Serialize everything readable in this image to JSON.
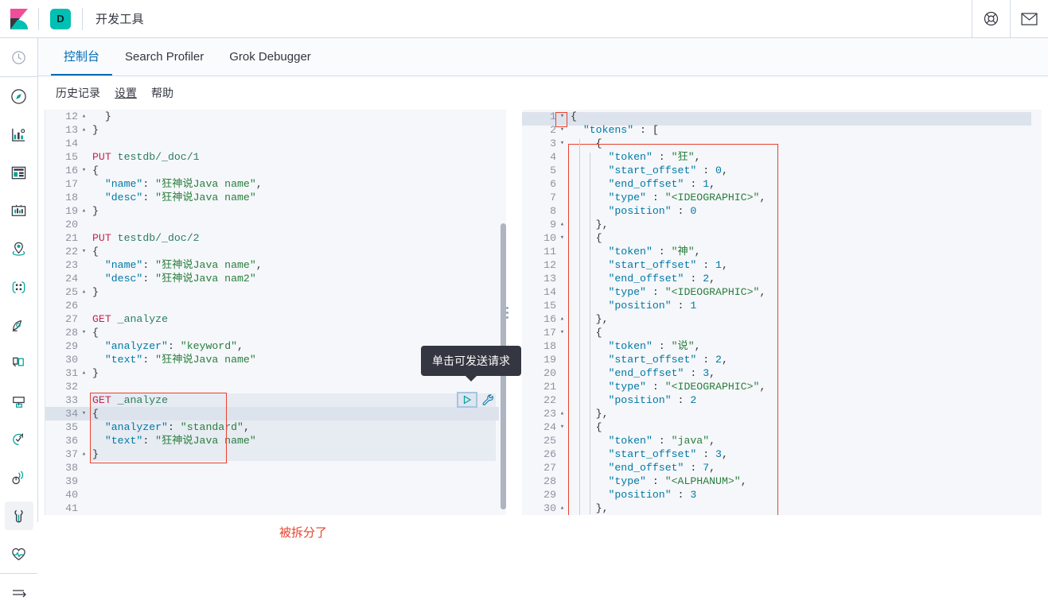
{
  "header": {
    "logo_icon": "kibana-logo",
    "space_badge": "D",
    "app_title": "开发工具",
    "help_icon": "lifebuoy-help-icon",
    "mail_icon": "envelope-icon"
  },
  "sidebar": {
    "items": [
      {
        "icon": "clock-recently-viewed-icon",
        "active": false
      },
      {
        "icon": "compass-discover-icon",
        "active": false
      },
      {
        "icon": "bar-chart-visualize-icon",
        "active": false
      },
      {
        "icon": "dashboard-icon",
        "active": false
      },
      {
        "icon": "canvas-icon",
        "active": false
      },
      {
        "icon": "maps-location-icon",
        "active": false
      },
      {
        "icon": "machine-learning-icon",
        "active": false
      },
      {
        "icon": "infra-metrics-icon",
        "active": false
      },
      {
        "icon": "logs-icon",
        "active": false
      },
      {
        "icon": "apm-icon",
        "active": false
      },
      {
        "icon": "uptime-signal-icon",
        "active": false
      },
      {
        "icon": "wrench-dev-tools-icon",
        "active": true
      },
      {
        "icon": "heartbeat-monitoring-icon",
        "active": false
      },
      {
        "icon": "collapse-arrow-icon",
        "active": false
      }
    ]
  },
  "tabs": [
    {
      "label": "控制台",
      "active": true
    },
    {
      "label": "Search Profiler",
      "active": false
    },
    {
      "label": "Grok Debugger",
      "active": false
    }
  ],
  "console_toolbar": {
    "links": [
      {
        "label": "历史记录",
        "underline": false
      },
      {
        "label": "设置",
        "underline": true
      },
      {
        "label": "帮助",
        "underline": false
      }
    ]
  },
  "tooltip": {
    "text": "单击可发送请求"
  },
  "annotations": {
    "note_text": "被拆分了",
    "note_color": "#e8422e"
  },
  "actions": {
    "play_icon": "play-send-request-icon",
    "wrench_icon": "wrench-settings-icon"
  },
  "request_editor": {
    "first_line_number": 12,
    "lines": [
      {
        "n": 12,
        "fold": "up",
        "tokens": [
          {
            "t": "  }",
            "c": "brace"
          }
        ]
      },
      {
        "n": 13,
        "fold": "up",
        "tokens": [
          {
            "t": "}",
            "c": "brace"
          }
        ]
      },
      {
        "n": 14,
        "fold": "",
        "tokens": []
      },
      {
        "n": 15,
        "fold": "",
        "tokens": [
          {
            "t": "PUT",
            "c": "method"
          },
          {
            "t": " ",
            "c": "punc"
          },
          {
            "t": "testdb/_doc/1",
            "c": "url"
          }
        ]
      },
      {
        "n": 16,
        "fold": "down",
        "tokens": [
          {
            "t": "{",
            "c": "brace"
          }
        ]
      },
      {
        "n": 17,
        "fold": "",
        "tokens": [
          {
            "t": "  ",
            "c": "punc"
          },
          {
            "t": "\"name\"",
            "c": "key"
          },
          {
            "t": ": ",
            "c": "punc"
          },
          {
            "t": "\"狂神说Java name\"",
            "c": "str"
          },
          {
            "t": ",",
            "c": "punc"
          }
        ]
      },
      {
        "n": 18,
        "fold": "",
        "tokens": [
          {
            "t": "  ",
            "c": "punc"
          },
          {
            "t": "\"desc\"",
            "c": "key"
          },
          {
            "t": ": ",
            "c": "punc"
          },
          {
            "t": "\"狂神说Java name\"",
            "c": "str"
          }
        ]
      },
      {
        "n": 19,
        "fold": "up",
        "tokens": [
          {
            "t": "}",
            "c": "brace"
          }
        ]
      },
      {
        "n": 20,
        "fold": "",
        "tokens": []
      },
      {
        "n": 21,
        "fold": "",
        "tokens": [
          {
            "t": "PUT",
            "c": "method"
          },
          {
            "t": " ",
            "c": "punc"
          },
          {
            "t": "testdb/_doc/2",
            "c": "url"
          }
        ]
      },
      {
        "n": 22,
        "fold": "down",
        "tokens": [
          {
            "t": "{",
            "c": "brace"
          }
        ]
      },
      {
        "n": 23,
        "fold": "",
        "tokens": [
          {
            "t": "  ",
            "c": "punc"
          },
          {
            "t": "\"name\"",
            "c": "key"
          },
          {
            "t": ": ",
            "c": "punc"
          },
          {
            "t": "\"狂神说Java name\"",
            "c": "str"
          },
          {
            "t": ",",
            "c": "punc"
          }
        ]
      },
      {
        "n": 24,
        "fold": "",
        "tokens": [
          {
            "t": "  ",
            "c": "punc"
          },
          {
            "t": "\"desc\"",
            "c": "key"
          },
          {
            "t": ": ",
            "c": "punc"
          },
          {
            "t": "\"狂神说Java nam2\"",
            "c": "str"
          }
        ]
      },
      {
        "n": 25,
        "fold": "up",
        "tokens": [
          {
            "t": "}",
            "c": "brace"
          }
        ]
      },
      {
        "n": 26,
        "fold": "",
        "tokens": []
      },
      {
        "n": 27,
        "fold": "",
        "tokens": [
          {
            "t": "GET",
            "c": "method"
          },
          {
            "t": " ",
            "c": "punc"
          },
          {
            "t": "_analyze",
            "c": "url"
          }
        ]
      },
      {
        "n": 28,
        "fold": "down",
        "tokens": [
          {
            "t": "{",
            "c": "brace"
          }
        ]
      },
      {
        "n": 29,
        "fold": "",
        "tokens": [
          {
            "t": "  ",
            "c": "punc"
          },
          {
            "t": "\"analyzer\"",
            "c": "key"
          },
          {
            "t": ": ",
            "c": "punc"
          },
          {
            "t": "\"keyword\"",
            "c": "str"
          },
          {
            "t": ",",
            "c": "punc"
          }
        ]
      },
      {
        "n": 30,
        "fold": "",
        "tokens": [
          {
            "t": "  ",
            "c": "punc"
          },
          {
            "t": "\"text\"",
            "c": "key"
          },
          {
            "t": ": ",
            "c": "punc"
          },
          {
            "t": "\"狂神说Java name\"",
            "c": "str"
          }
        ]
      },
      {
        "n": 31,
        "fold": "up",
        "tokens": [
          {
            "t": "}",
            "c": "brace"
          }
        ]
      },
      {
        "n": 32,
        "fold": "",
        "tokens": []
      },
      {
        "n": 33,
        "fold": "",
        "tokens": [
          {
            "t": "GET",
            "c": "method"
          },
          {
            "t": " ",
            "c": "punc"
          },
          {
            "t": "_analyze",
            "c": "url"
          }
        ]
      },
      {
        "n": 34,
        "fold": "down",
        "tokens": [
          {
            "t": "{",
            "c": "brace"
          }
        ]
      },
      {
        "n": 35,
        "fold": "",
        "tokens": [
          {
            "t": "  ",
            "c": "punc"
          },
          {
            "t": "\"analyzer\"",
            "c": "key"
          },
          {
            "t": ": ",
            "c": "punc"
          },
          {
            "t": "\"standard\"",
            "c": "str"
          },
          {
            "t": ",",
            "c": "punc"
          }
        ]
      },
      {
        "n": 36,
        "fold": "",
        "tokens": [
          {
            "t": "  ",
            "c": "punc"
          },
          {
            "t": "\"text\"",
            "c": "key"
          },
          {
            "t": ": ",
            "c": "punc"
          },
          {
            "t": "\"狂神说Java name\"",
            "c": "str"
          }
        ]
      },
      {
        "n": 37,
        "fold": "up",
        "tokens": [
          {
            "t": "}",
            "c": "brace"
          }
        ]
      },
      {
        "n": 38,
        "fold": "",
        "tokens": []
      },
      {
        "n": 39,
        "fold": "",
        "tokens": []
      },
      {
        "n": 40,
        "fold": "",
        "tokens": []
      },
      {
        "n": 41,
        "fold": "",
        "tokens": []
      }
    ]
  },
  "response_editor": {
    "lines": [
      {
        "n": 1,
        "fold": "down",
        "tokens": [
          {
            "t": "{",
            "c": "brace"
          }
        ]
      },
      {
        "n": 2,
        "fold": "down",
        "tokens": [
          {
            "t": "  ",
            "c": "punc"
          },
          {
            "t": "\"tokens\"",
            "c": "key"
          },
          {
            "t": " : [",
            "c": "punc"
          }
        ]
      },
      {
        "n": 3,
        "fold": "down",
        "tokens": [
          {
            "t": "    {",
            "c": "brace"
          }
        ]
      },
      {
        "n": 4,
        "fold": "",
        "tokens": [
          {
            "t": "      ",
            "c": "punc"
          },
          {
            "t": "\"token\"",
            "c": "key"
          },
          {
            "t": " : ",
            "c": "punc"
          },
          {
            "t": "\"狂\"",
            "c": "str"
          },
          {
            "t": ",",
            "c": "punc"
          }
        ]
      },
      {
        "n": 5,
        "fold": "",
        "tokens": [
          {
            "t": "      ",
            "c": "punc"
          },
          {
            "t": "\"start_offset\"",
            "c": "key"
          },
          {
            "t": " : ",
            "c": "punc"
          },
          {
            "t": "0",
            "c": "num"
          },
          {
            "t": ",",
            "c": "punc"
          }
        ]
      },
      {
        "n": 6,
        "fold": "",
        "tokens": [
          {
            "t": "      ",
            "c": "punc"
          },
          {
            "t": "\"end_offset\"",
            "c": "key"
          },
          {
            "t": " : ",
            "c": "punc"
          },
          {
            "t": "1",
            "c": "num"
          },
          {
            "t": ",",
            "c": "punc"
          }
        ]
      },
      {
        "n": 7,
        "fold": "",
        "tokens": [
          {
            "t": "      ",
            "c": "punc"
          },
          {
            "t": "\"type\"",
            "c": "key"
          },
          {
            "t": " : ",
            "c": "punc"
          },
          {
            "t": "\"<IDEOGRAPHIC>\"",
            "c": "str"
          },
          {
            "t": ",",
            "c": "punc"
          }
        ]
      },
      {
        "n": 8,
        "fold": "",
        "tokens": [
          {
            "t": "      ",
            "c": "punc"
          },
          {
            "t": "\"position\"",
            "c": "key"
          },
          {
            "t": " : ",
            "c": "punc"
          },
          {
            "t": "0",
            "c": "num"
          }
        ]
      },
      {
        "n": 9,
        "fold": "up",
        "tokens": [
          {
            "t": "    },",
            "c": "brace"
          }
        ]
      },
      {
        "n": 10,
        "fold": "down",
        "tokens": [
          {
            "t": "    {",
            "c": "brace"
          }
        ]
      },
      {
        "n": 11,
        "fold": "",
        "tokens": [
          {
            "t": "      ",
            "c": "punc"
          },
          {
            "t": "\"token\"",
            "c": "key"
          },
          {
            "t": " : ",
            "c": "punc"
          },
          {
            "t": "\"神\"",
            "c": "str"
          },
          {
            "t": ",",
            "c": "punc"
          }
        ]
      },
      {
        "n": 12,
        "fold": "",
        "tokens": [
          {
            "t": "      ",
            "c": "punc"
          },
          {
            "t": "\"start_offset\"",
            "c": "key"
          },
          {
            "t": " : ",
            "c": "punc"
          },
          {
            "t": "1",
            "c": "num"
          },
          {
            "t": ",",
            "c": "punc"
          }
        ]
      },
      {
        "n": 13,
        "fold": "",
        "tokens": [
          {
            "t": "      ",
            "c": "punc"
          },
          {
            "t": "\"end_offset\"",
            "c": "key"
          },
          {
            "t": " : ",
            "c": "punc"
          },
          {
            "t": "2",
            "c": "num"
          },
          {
            "t": ",",
            "c": "punc"
          }
        ]
      },
      {
        "n": 14,
        "fold": "",
        "tokens": [
          {
            "t": "      ",
            "c": "punc"
          },
          {
            "t": "\"type\"",
            "c": "key"
          },
          {
            "t": " : ",
            "c": "punc"
          },
          {
            "t": "\"<IDEOGRAPHIC>\"",
            "c": "str"
          },
          {
            "t": ",",
            "c": "punc"
          }
        ]
      },
      {
        "n": 15,
        "fold": "",
        "tokens": [
          {
            "t": "      ",
            "c": "punc"
          },
          {
            "t": "\"position\"",
            "c": "key"
          },
          {
            "t": " : ",
            "c": "punc"
          },
          {
            "t": "1",
            "c": "num"
          }
        ]
      },
      {
        "n": 16,
        "fold": "up",
        "tokens": [
          {
            "t": "    },",
            "c": "brace"
          }
        ]
      },
      {
        "n": 17,
        "fold": "down",
        "tokens": [
          {
            "t": "    {",
            "c": "brace"
          }
        ]
      },
      {
        "n": 18,
        "fold": "",
        "tokens": [
          {
            "t": "      ",
            "c": "punc"
          },
          {
            "t": "\"token\"",
            "c": "key"
          },
          {
            "t": " : ",
            "c": "punc"
          },
          {
            "t": "\"说\"",
            "c": "str"
          },
          {
            "t": ",",
            "c": "punc"
          }
        ]
      },
      {
        "n": 19,
        "fold": "",
        "tokens": [
          {
            "t": "      ",
            "c": "punc"
          },
          {
            "t": "\"start_offset\"",
            "c": "key"
          },
          {
            "t": " : ",
            "c": "punc"
          },
          {
            "t": "2",
            "c": "num"
          },
          {
            "t": ",",
            "c": "punc"
          }
        ]
      },
      {
        "n": 20,
        "fold": "",
        "tokens": [
          {
            "t": "      ",
            "c": "punc"
          },
          {
            "t": "\"end_offset\"",
            "c": "key"
          },
          {
            "t": " : ",
            "c": "punc"
          },
          {
            "t": "3",
            "c": "num"
          },
          {
            "t": ",",
            "c": "punc"
          }
        ]
      },
      {
        "n": 21,
        "fold": "",
        "tokens": [
          {
            "t": "      ",
            "c": "punc"
          },
          {
            "t": "\"type\"",
            "c": "key"
          },
          {
            "t": " : ",
            "c": "punc"
          },
          {
            "t": "\"<IDEOGRAPHIC>\"",
            "c": "str"
          },
          {
            "t": ",",
            "c": "punc"
          }
        ]
      },
      {
        "n": 22,
        "fold": "",
        "tokens": [
          {
            "t": "      ",
            "c": "punc"
          },
          {
            "t": "\"position\"",
            "c": "key"
          },
          {
            "t": " : ",
            "c": "punc"
          },
          {
            "t": "2",
            "c": "num"
          }
        ]
      },
      {
        "n": 23,
        "fold": "up",
        "tokens": [
          {
            "t": "    },",
            "c": "brace"
          }
        ]
      },
      {
        "n": 24,
        "fold": "down",
        "tokens": [
          {
            "t": "    {",
            "c": "brace"
          }
        ]
      },
      {
        "n": 25,
        "fold": "",
        "tokens": [
          {
            "t": "      ",
            "c": "punc"
          },
          {
            "t": "\"token\"",
            "c": "key"
          },
          {
            "t": " : ",
            "c": "punc"
          },
          {
            "t": "\"java\"",
            "c": "str"
          },
          {
            "t": ",",
            "c": "punc"
          }
        ]
      },
      {
        "n": 26,
        "fold": "",
        "tokens": [
          {
            "t": "      ",
            "c": "punc"
          },
          {
            "t": "\"start_offset\"",
            "c": "key"
          },
          {
            "t": " : ",
            "c": "punc"
          },
          {
            "t": "3",
            "c": "num"
          },
          {
            "t": ",",
            "c": "punc"
          }
        ]
      },
      {
        "n": 27,
        "fold": "",
        "tokens": [
          {
            "t": "      ",
            "c": "punc"
          },
          {
            "t": "\"end_offset\"",
            "c": "key"
          },
          {
            "t": " : ",
            "c": "punc"
          },
          {
            "t": "7",
            "c": "num"
          },
          {
            "t": ",",
            "c": "punc"
          }
        ]
      },
      {
        "n": 28,
        "fold": "",
        "tokens": [
          {
            "t": "      ",
            "c": "punc"
          },
          {
            "t": "\"type\"",
            "c": "key"
          },
          {
            "t": " : ",
            "c": "punc"
          },
          {
            "t": "\"<ALPHANUM>\"",
            "c": "str"
          },
          {
            "t": ",",
            "c": "punc"
          }
        ]
      },
      {
        "n": 29,
        "fold": "",
        "tokens": [
          {
            "t": "      ",
            "c": "punc"
          },
          {
            "t": "\"position\"",
            "c": "key"
          },
          {
            "t": " : ",
            "c": "punc"
          },
          {
            "t": "3",
            "c": "num"
          }
        ]
      },
      {
        "n": 30,
        "fold": "up",
        "tokens": [
          {
            "t": "    },",
            "c": "brace"
          }
        ]
      }
    ]
  }
}
